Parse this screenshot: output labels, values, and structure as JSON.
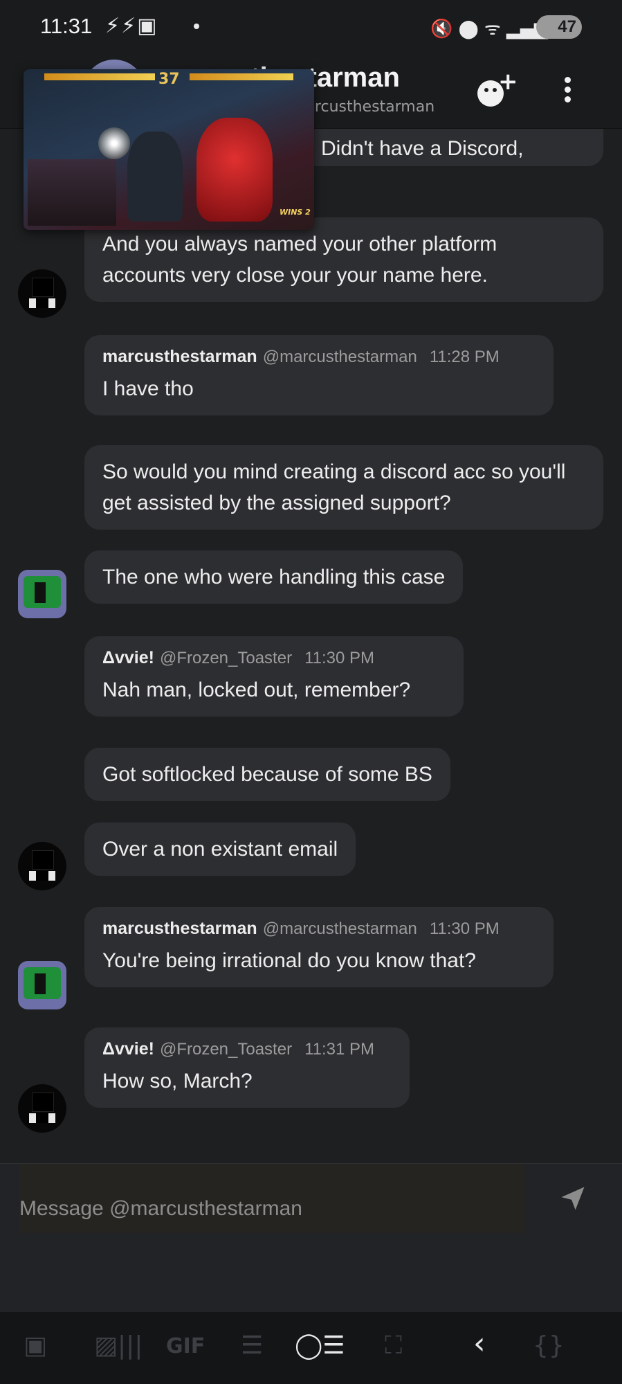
{
  "status_bar": {
    "time": "11:31",
    "left_icons": "⚡⚡▣",
    "right_icons": "🔇 ⬤ ᯤ ▂▄▆",
    "battery": "47"
  },
  "header": {
    "title": "marcusthestarman",
    "subtitle": "marcusthestarman"
  },
  "pip": {
    "round": "37",
    "wins_label": "WINS 2"
  },
  "messages": [
    {
      "text": "Didn't have a Discord,",
      "partial": true
    },
    {
      "text": "And you always named your other platform accounts very close your your name here."
    },
    {
      "author": "marcusthestarman",
      "handle": "@marcusthestarman",
      "time": "11:28 PM",
      "text": "I have tho"
    },
    {
      "text": "So would you mind creating a discord acc so you'll get assisted by the assigned support?"
    },
    {
      "text": "The one who were handling this case"
    },
    {
      "author": "Δvvie!",
      "handle": "@Frozen_Toaster",
      "time": "11:30 PM",
      "text": "Nah man, locked out, remember?"
    },
    {
      "text": "Got softlocked because of some BS"
    },
    {
      "text": "Over a non existant email"
    },
    {
      "author": "marcusthestarman",
      "handle": "@marcusthestarman",
      "time": "11:30 PM",
      "text": "You're being irrational do you know that?"
    },
    {
      "author": "Δvvie!",
      "handle": "@Frozen_Toaster",
      "time": "11:31 PM",
      "text": "How so, March?"
    }
  ],
  "composer": {
    "placeholder": "Message @marcusthestarman"
  },
  "keyboard_toolbar": {
    "icons": [
      "sticker-icon",
      "image-icon",
      "gif-icon",
      "list-icon",
      "text-format-icon",
      "screenshot-icon",
      "back-icon",
      "code-icon"
    ],
    "labels": [
      "▣",
      "▨|||",
      "GIF",
      "☰",
      "◯☰",
      "⛶",
      "‹",
      "{}"
    ]
  }
}
